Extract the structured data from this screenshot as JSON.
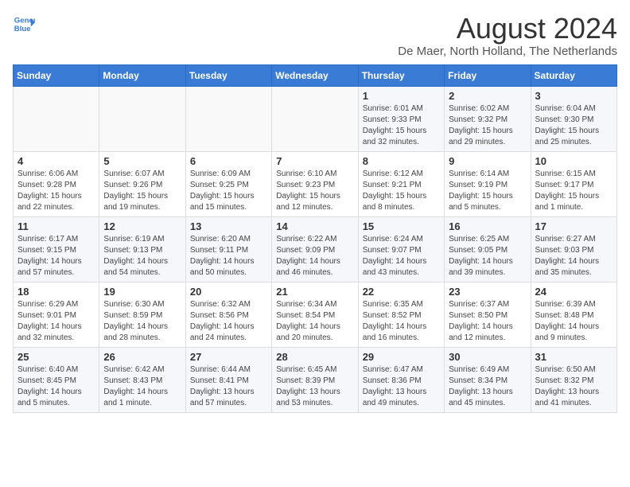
{
  "header": {
    "logo_line1": "General",
    "logo_line2": "Blue",
    "month_year": "August 2024",
    "location": "De Maer, North Holland, The Netherlands"
  },
  "days_of_week": [
    "Sunday",
    "Monday",
    "Tuesday",
    "Wednesday",
    "Thursday",
    "Friday",
    "Saturday"
  ],
  "weeks": [
    [
      {
        "day": "",
        "content": ""
      },
      {
        "day": "",
        "content": ""
      },
      {
        "day": "",
        "content": ""
      },
      {
        "day": "",
        "content": ""
      },
      {
        "day": "1",
        "content": "Sunrise: 6:01 AM\nSunset: 9:33 PM\nDaylight: 15 hours\nand 32 minutes."
      },
      {
        "day": "2",
        "content": "Sunrise: 6:02 AM\nSunset: 9:32 PM\nDaylight: 15 hours\nand 29 minutes."
      },
      {
        "day": "3",
        "content": "Sunrise: 6:04 AM\nSunset: 9:30 PM\nDaylight: 15 hours\nand 25 minutes."
      }
    ],
    [
      {
        "day": "4",
        "content": "Sunrise: 6:06 AM\nSunset: 9:28 PM\nDaylight: 15 hours\nand 22 minutes."
      },
      {
        "day": "5",
        "content": "Sunrise: 6:07 AM\nSunset: 9:26 PM\nDaylight: 15 hours\nand 19 minutes."
      },
      {
        "day": "6",
        "content": "Sunrise: 6:09 AM\nSunset: 9:25 PM\nDaylight: 15 hours\nand 15 minutes."
      },
      {
        "day": "7",
        "content": "Sunrise: 6:10 AM\nSunset: 9:23 PM\nDaylight: 15 hours\nand 12 minutes."
      },
      {
        "day": "8",
        "content": "Sunrise: 6:12 AM\nSunset: 9:21 PM\nDaylight: 15 hours\nand 8 minutes."
      },
      {
        "day": "9",
        "content": "Sunrise: 6:14 AM\nSunset: 9:19 PM\nDaylight: 15 hours\nand 5 minutes."
      },
      {
        "day": "10",
        "content": "Sunrise: 6:15 AM\nSunset: 9:17 PM\nDaylight: 15 hours\nand 1 minute."
      }
    ],
    [
      {
        "day": "11",
        "content": "Sunrise: 6:17 AM\nSunset: 9:15 PM\nDaylight: 14 hours\nand 57 minutes."
      },
      {
        "day": "12",
        "content": "Sunrise: 6:19 AM\nSunset: 9:13 PM\nDaylight: 14 hours\nand 54 minutes."
      },
      {
        "day": "13",
        "content": "Sunrise: 6:20 AM\nSunset: 9:11 PM\nDaylight: 14 hours\nand 50 minutes."
      },
      {
        "day": "14",
        "content": "Sunrise: 6:22 AM\nSunset: 9:09 PM\nDaylight: 14 hours\nand 46 minutes."
      },
      {
        "day": "15",
        "content": "Sunrise: 6:24 AM\nSunset: 9:07 PM\nDaylight: 14 hours\nand 43 minutes."
      },
      {
        "day": "16",
        "content": "Sunrise: 6:25 AM\nSunset: 9:05 PM\nDaylight: 14 hours\nand 39 minutes."
      },
      {
        "day": "17",
        "content": "Sunrise: 6:27 AM\nSunset: 9:03 PM\nDaylight: 14 hours\nand 35 minutes."
      }
    ],
    [
      {
        "day": "18",
        "content": "Sunrise: 6:29 AM\nSunset: 9:01 PM\nDaylight: 14 hours\nand 32 minutes."
      },
      {
        "day": "19",
        "content": "Sunrise: 6:30 AM\nSunset: 8:59 PM\nDaylight: 14 hours\nand 28 minutes."
      },
      {
        "day": "20",
        "content": "Sunrise: 6:32 AM\nSunset: 8:56 PM\nDaylight: 14 hours\nand 24 minutes."
      },
      {
        "day": "21",
        "content": "Sunrise: 6:34 AM\nSunset: 8:54 PM\nDaylight: 14 hours\nand 20 minutes."
      },
      {
        "day": "22",
        "content": "Sunrise: 6:35 AM\nSunset: 8:52 PM\nDaylight: 14 hours\nand 16 minutes."
      },
      {
        "day": "23",
        "content": "Sunrise: 6:37 AM\nSunset: 8:50 PM\nDaylight: 14 hours\nand 12 minutes."
      },
      {
        "day": "24",
        "content": "Sunrise: 6:39 AM\nSunset: 8:48 PM\nDaylight: 14 hours\nand 9 minutes."
      }
    ],
    [
      {
        "day": "25",
        "content": "Sunrise: 6:40 AM\nSunset: 8:45 PM\nDaylight: 14 hours\nand 5 minutes."
      },
      {
        "day": "26",
        "content": "Sunrise: 6:42 AM\nSunset: 8:43 PM\nDaylight: 14 hours\nand 1 minute."
      },
      {
        "day": "27",
        "content": "Sunrise: 6:44 AM\nSunset: 8:41 PM\nDaylight: 13 hours\nand 57 minutes."
      },
      {
        "day": "28",
        "content": "Sunrise: 6:45 AM\nSunset: 8:39 PM\nDaylight: 13 hours\nand 53 minutes."
      },
      {
        "day": "29",
        "content": "Sunrise: 6:47 AM\nSunset: 8:36 PM\nDaylight: 13 hours\nand 49 minutes."
      },
      {
        "day": "30",
        "content": "Sunrise: 6:49 AM\nSunset: 8:34 PM\nDaylight: 13 hours\nand 45 minutes."
      },
      {
        "day": "31",
        "content": "Sunrise: 6:50 AM\nSunset: 8:32 PM\nDaylight: 13 hours\nand 41 minutes."
      }
    ]
  ]
}
